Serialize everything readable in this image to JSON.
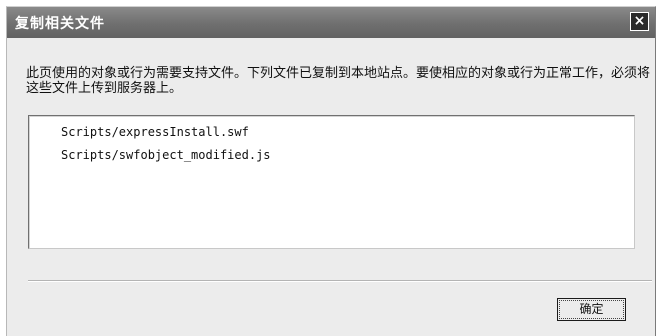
{
  "dialog": {
    "title": "复制相关文件",
    "close_label": "×",
    "message": "此页使用的对象或行为需要支持文件。下列文件已复制到本地站点。要使相应的对象或行为正常工作，必须将这些文件上传到服务器上。",
    "files": [
      "Scripts/expressInstall.swf",
      "Scripts/swfobject_modified.js"
    ],
    "ok_label": "确定"
  }
}
